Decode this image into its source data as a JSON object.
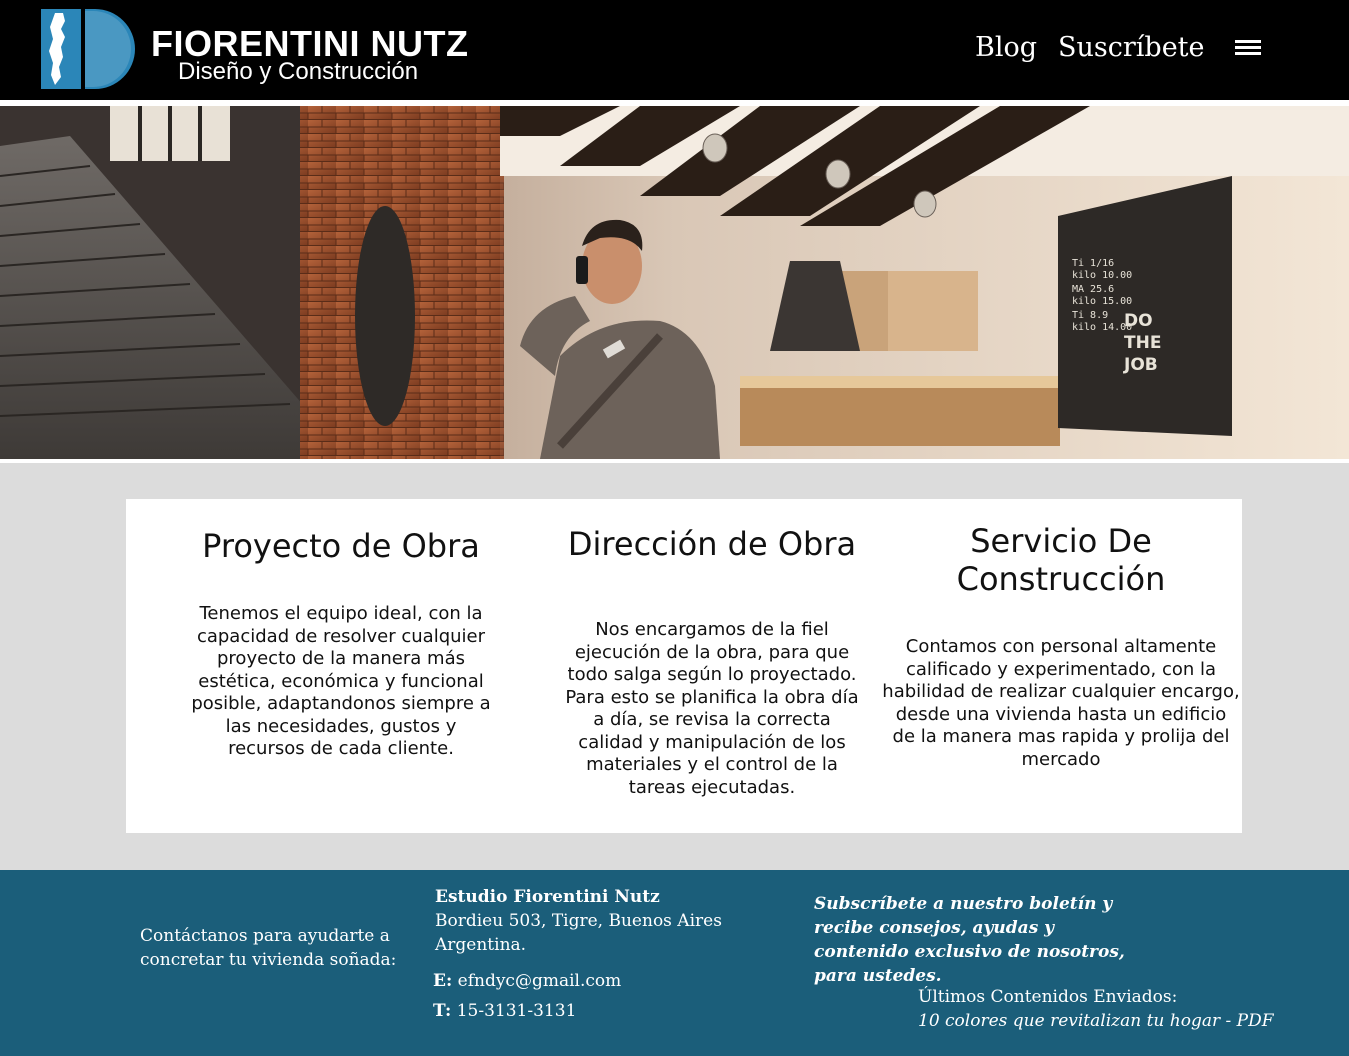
{
  "header": {
    "brand_title": "FIORENTINI NUTZ",
    "brand_subtitle": "Diseño y Construcción",
    "nav": {
      "blog": "Blog",
      "subscribe": "Suscríbete"
    }
  },
  "hero": {
    "chalkboard": [
      "Ti 1/16",
      "kilo 10.00",
      "MA 25.6",
      "kilo 15.00",
      "Ti 8.9",
      "kilo 14.00"
    ],
    "chalkboard_motto": [
      "DO",
      "THE",
      "JOB"
    ]
  },
  "services": [
    {
      "title": "Proyecto de Obra",
      "text": "Tenemos el equipo ideal, con la capacidad de resolver cualquier proyecto de la manera más estética, económica y funcional posible, adaptandonos siempre a las necesidades, gustos y recursos de cada cliente."
    },
    {
      "title": "Dirección de Obra",
      "text": "Nos encargamos de la fiel ejecución de la obra, para que todo salga según lo proyectado. Para esto se planifica la obra día a día, se revisa la correcta calidad y manipulación de los materiales y el control de la tareas ejecutadas."
    },
    {
      "title": "Servicio De Construcción",
      "text": "Contamos con personal altamente calificado y experimentado, con la habilidad de realizar cualquier encargo, desde una vivienda hasta un edificio de la manera mas rapida y prolija del mercado"
    }
  ],
  "footer": {
    "contact_prompt": "Contáctanos para ayudarte a concretar tu vivienda soñada:",
    "studio_name": "Estudio Fiorentini Nutz",
    "address_line1": "Bordieu 503, Tigre, Buenos Aires",
    "address_line2": "Argentina.",
    "email_label": "E:",
    "email": "efndyc@gmail.com",
    "phone_label": "T:",
    "phone": "15-3131-3131",
    "newsletter_text": "Subscríbete a nuestro boletín y recibe consejos, ayudas y contenido exclusivo de nosotros,  para ustedes.",
    "latest_heading": "Últimos Contenidos Enviados:",
    "latest_item": "10 colores que revitalizan tu hogar - PDF"
  },
  "colors": {
    "header_bg": "#000000",
    "footer_bg": "#1b5e7a",
    "logo_blue": "#2b86b8",
    "page_bg": "#dcdcdc"
  }
}
